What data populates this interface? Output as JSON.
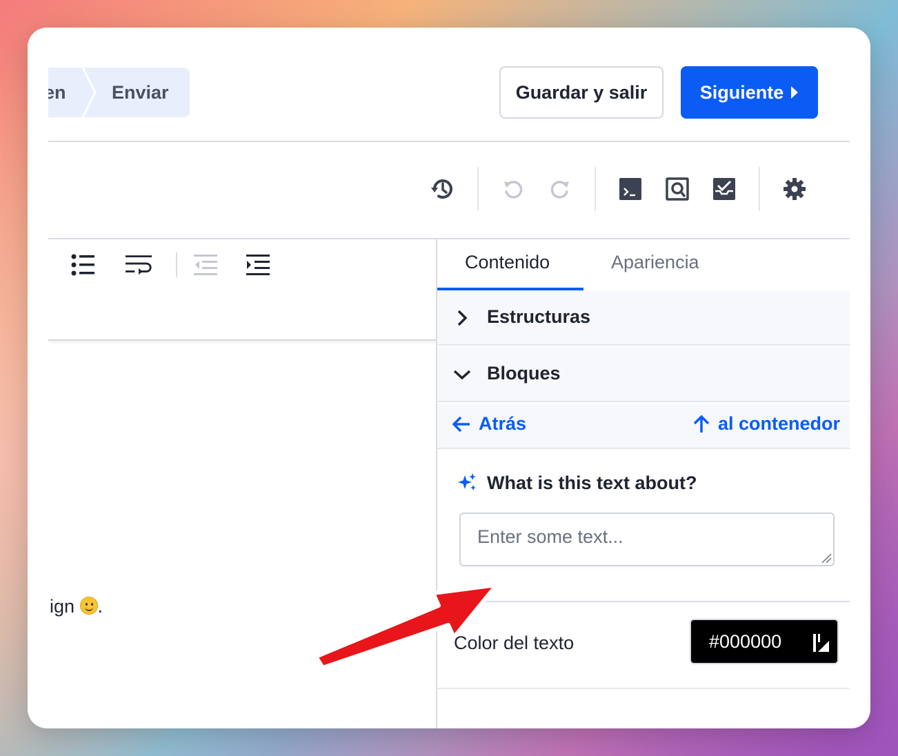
{
  "breadcrumb": {
    "prev": "en",
    "current": "Enviar"
  },
  "header": {
    "save_exit": "Guardar y salir",
    "next": "Siguiente"
  },
  "toolbar": {
    "icons": [
      "history-icon",
      "undo-icon",
      "redo-icon",
      "code-icon",
      "preview-icon",
      "test-icon",
      "settings-icon"
    ]
  },
  "editor": {
    "toolbar_icons": [
      "bullet-list-icon",
      "wrap-icon",
      "outdent-icon",
      "indent-icon"
    ],
    "text": "ign ",
    "text_end": "."
  },
  "panel": {
    "tabs": [
      {
        "label": "Contenido",
        "active": true
      },
      {
        "label": "Apariencia",
        "active": false
      }
    ],
    "accordions": [
      {
        "label": "Estructuras",
        "expanded": false
      },
      {
        "label": "Bloques",
        "expanded": true
      }
    ],
    "nav": {
      "back": "Atrás",
      "up": "al contenedor"
    },
    "ai": {
      "label": "What is this text about?",
      "placeholder": "Enter some text..."
    },
    "text_color": {
      "label": "Color del texto",
      "value": "#000000"
    }
  },
  "colors": {
    "accent": "#0a5cf5",
    "arrow": "#e8151b"
  }
}
